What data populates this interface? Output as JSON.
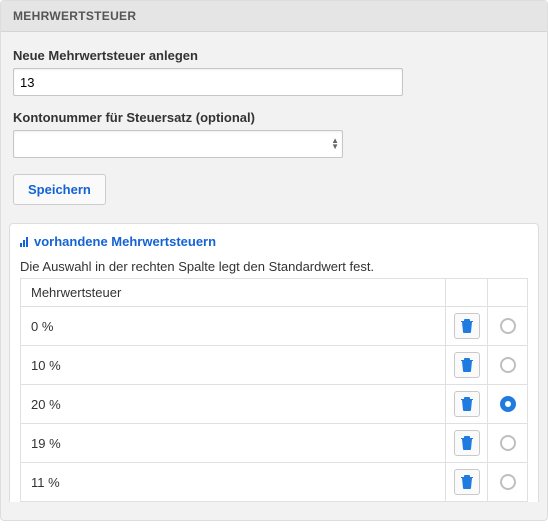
{
  "panel": {
    "title": "MEHRWERTSTEUER"
  },
  "form": {
    "newVatLabel": "Neue Mehrwertsteuer anlegen",
    "newVatValue": "13",
    "accountLabel": "Kontonummer für Steuersatz (optional)",
    "accountValue": "",
    "saveLabel": "Speichern"
  },
  "list": {
    "title": "vorhandene Mehrwertsteuern",
    "hint": "Die Auswahl in der rechten Spalte legt den Standardwert fest.",
    "columnLabel": "Mehrwertsteuer",
    "rows": [
      {
        "label": "0 %",
        "selected": false
      },
      {
        "label": "10 %",
        "selected": false
      },
      {
        "label": "20 %",
        "selected": true
      },
      {
        "label": "19 %",
        "selected": false
      },
      {
        "label": "11 %",
        "selected": false
      }
    ]
  },
  "icons": {
    "trashColor": "#1f7be0"
  }
}
